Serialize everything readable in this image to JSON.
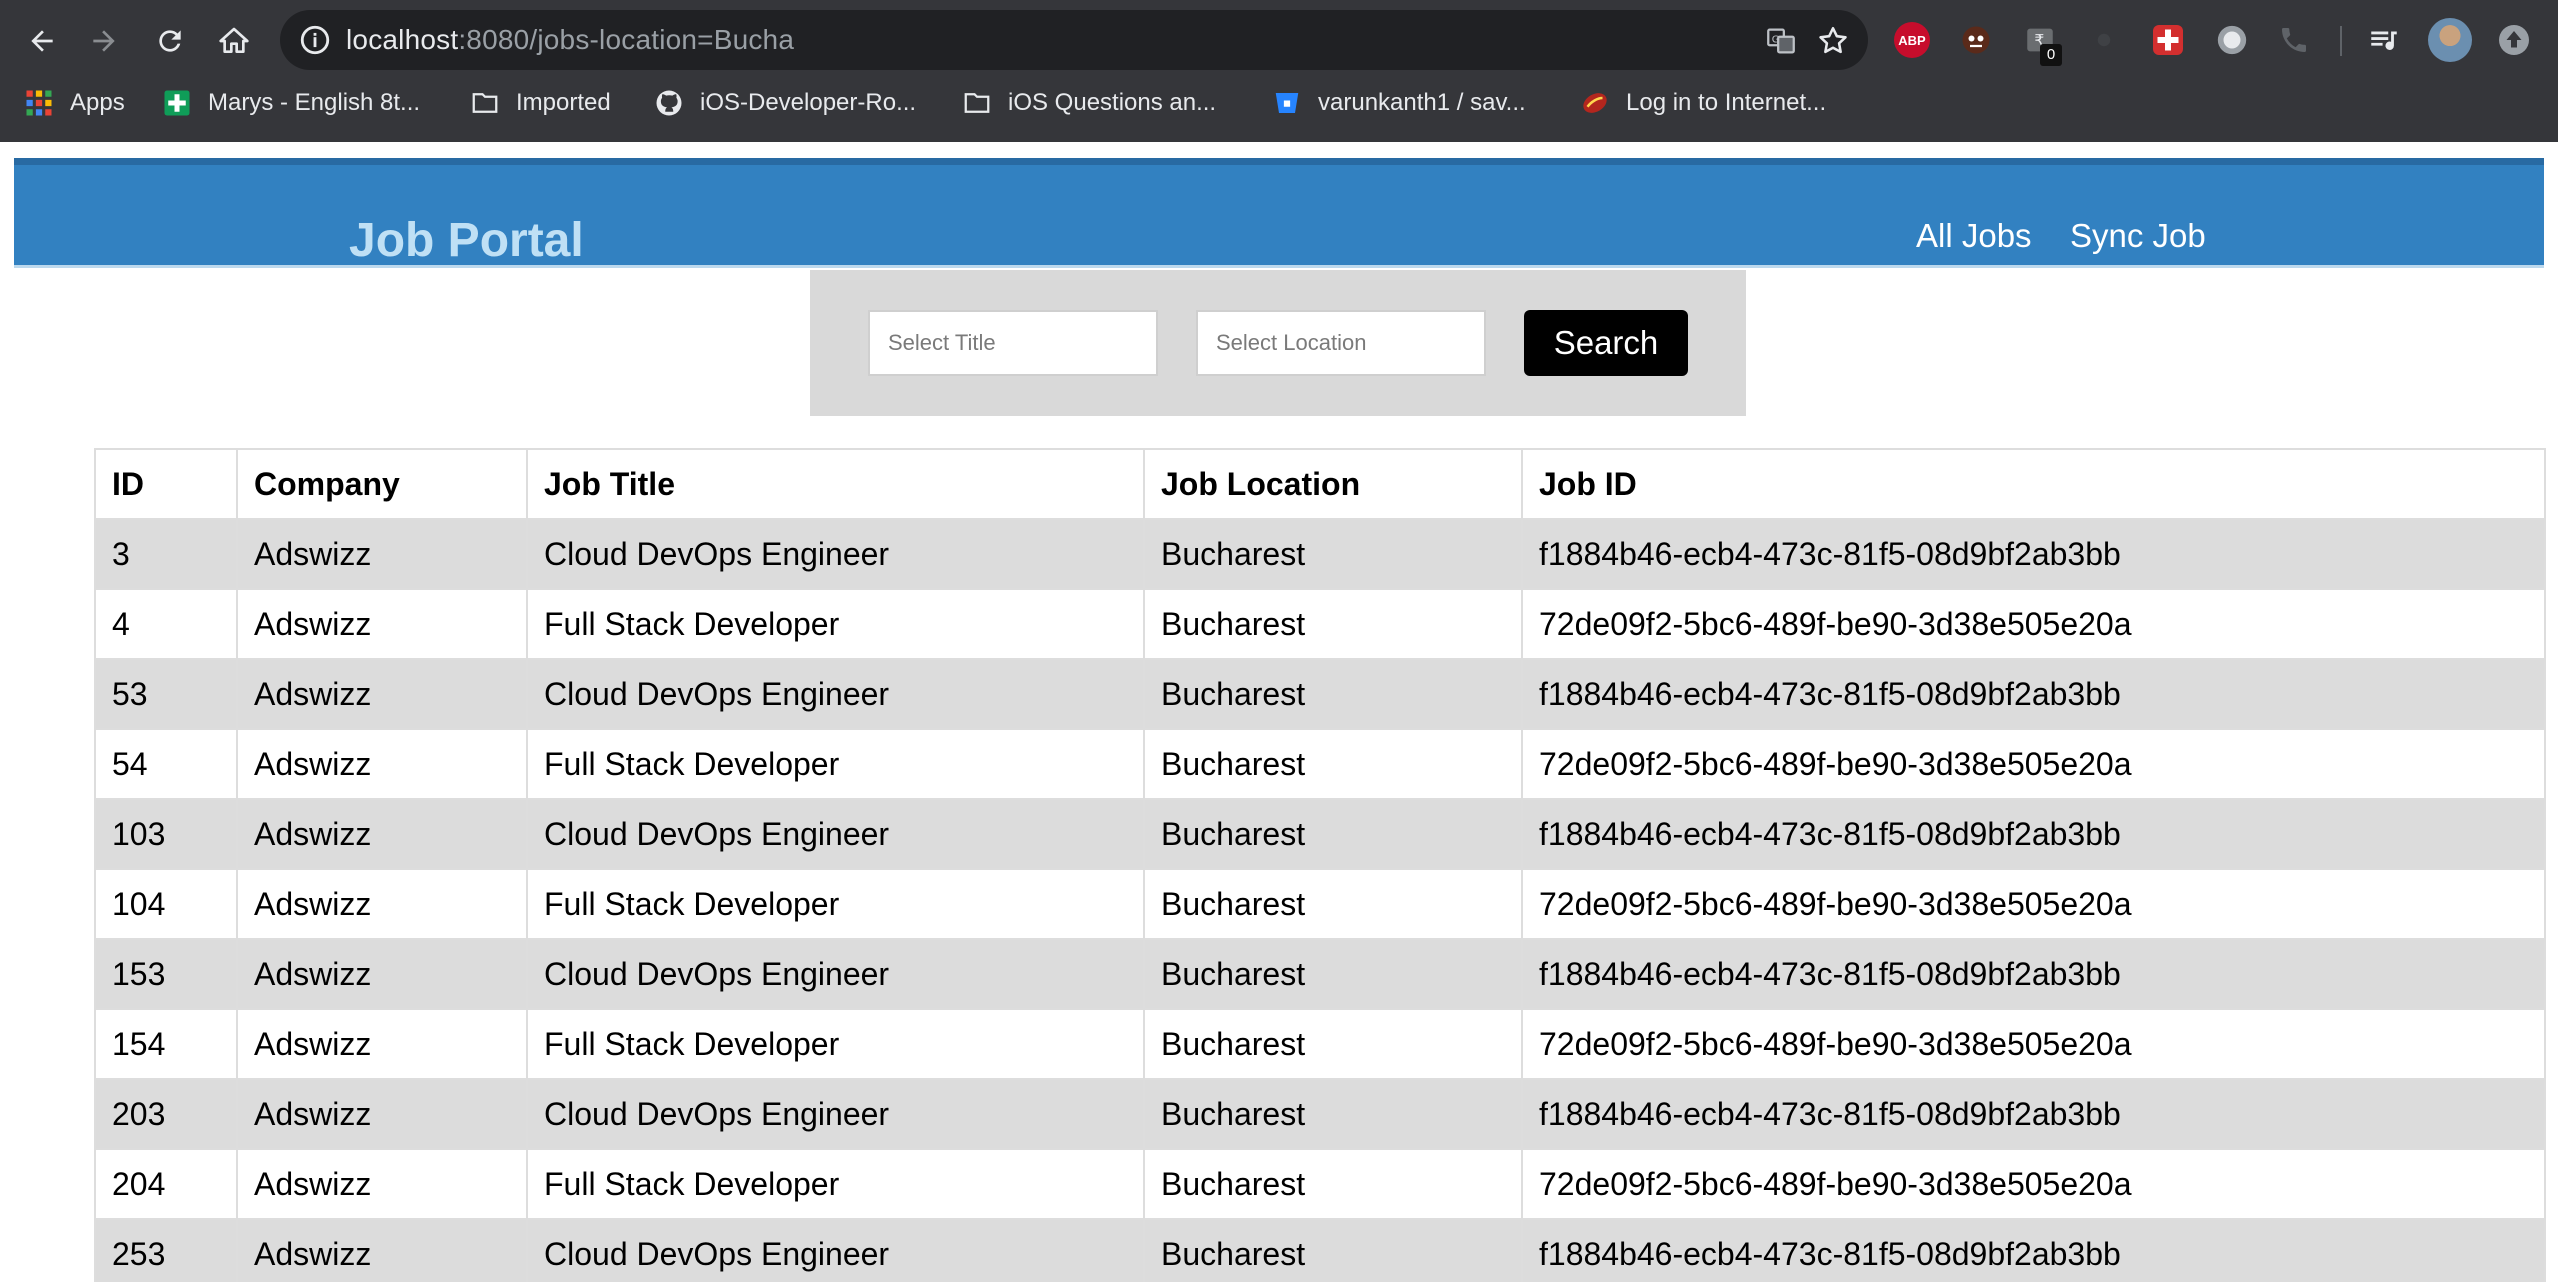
{
  "browser": {
    "url_host": "localhost",
    "url_path": ":8080/jobs-location=Bucha",
    "extensions": {
      "abp_label": "ABP",
      "badge_count": "0"
    },
    "bookmarks": [
      {
        "label": "Apps",
        "icon": "apps-grid-icon"
      },
      {
        "label": "Marys - English 8t...",
        "icon": "green-plus-icon"
      },
      {
        "label": "Imported",
        "icon": "folder-icon"
      },
      {
        "label": "iOS-Developer-Ro...",
        "icon": "github-icon"
      },
      {
        "label": "iOS Questions an...",
        "icon": "folder-icon"
      },
      {
        "label": "varunkanth1 / sav...",
        "icon": "bitbucket-icon"
      },
      {
        "label": "Log in to Internet...",
        "icon": "router-icon"
      }
    ]
  },
  "header": {
    "brand": "Job Portal",
    "nav": {
      "all_jobs": "All Jobs",
      "sync_job": "Sync Job"
    }
  },
  "search": {
    "title_placeholder": "Select Title",
    "location_placeholder": "Select Location",
    "button_label": "Search"
  },
  "table": {
    "columns": [
      "ID",
      "Company",
      "Job Title",
      "Job Location",
      "Job ID"
    ],
    "rows": [
      [
        "3",
        "Adswizz",
        "Cloud DevOps Engineer",
        "Bucharest",
        "f1884b46-ecb4-473c-81f5-08d9bf2ab3bb"
      ],
      [
        "4",
        "Adswizz",
        "Full Stack Developer",
        "Bucharest",
        "72de09f2-5bc6-489f-be90-3d38e505e20a"
      ],
      [
        "53",
        "Adswizz",
        "Cloud DevOps Engineer",
        "Bucharest",
        "f1884b46-ecb4-473c-81f5-08d9bf2ab3bb"
      ],
      [
        "54",
        "Adswizz",
        "Full Stack Developer",
        "Bucharest",
        "72de09f2-5bc6-489f-be90-3d38e505e20a"
      ],
      [
        "103",
        "Adswizz",
        "Cloud DevOps Engineer",
        "Bucharest",
        "f1884b46-ecb4-473c-81f5-08d9bf2ab3bb"
      ],
      [
        "104",
        "Adswizz",
        "Full Stack Developer",
        "Bucharest",
        "72de09f2-5bc6-489f-be90-3d38e505e20a"
      ],
      [
        "153",
        "Adswizz",
        "Cloud DevOps Engineer",
        "Bucharest",
        "f1884b46-ecb4-473c-81f5-08d9bf2ab3bb"
      ],
      [
        "154",
        "Adswizz",
        "Full Stack Developer",
        "Bucharest",
        "72de09f2-5bc6-489f-be90-3d38e505e20a"
      ],
      [
        "203",
        "Adswizz",
        "Cloud DevOps Engineer",
        "Bucharest",
        "f1884b46-ecb4-473c-81f5-08d9bf2ab3bb"
      ],
      [
        "204",
        "Adswizz",
        "Full Stack Developer",
        "Bucharest",
        "72de09f2-5bc6-489f-be90-3d38e505e20a"
      ],
      [
        "253",
        "Adswizz",
        "Cloud DevOps Engineer",
        "Bucharest",
        "f1884b46-ecb4-473c-81f5-08d9bf2ab3bb"
      ]
    ]
  },
  "colors": {
    "header_blue": "#3281c1",
    "brand_text": "#bfe0f5",
    "stripe_gray": "#dcdcdc",
    "panel_gray": "#d9d9d9",
    "chrome_dark": "#35363a"
  }
}
